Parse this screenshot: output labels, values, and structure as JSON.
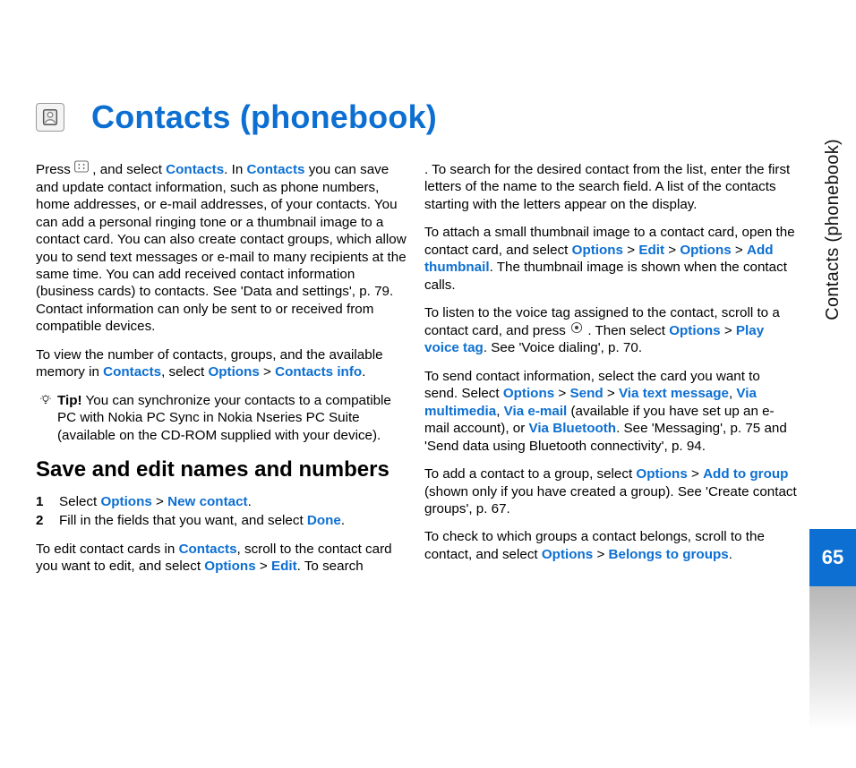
{
  "title": "Contacts (phonebook)",
  "side": {
    "label": "Contacts (phonebook)",
    "page": "65"
  },
  "intro": {
    "p1a": "Press ",
    "p1b": " , and select ",
    "p1c": "Contacts",
    "p1d": ". In ",
    "p1e": "Contacts",
    "p1f": " you can save and update contact information, such as phone numbers, home addresses, or e-mail addresses, of your contacts. You can add a personal ringing tone or a thumbnail image to a contact card. You can also create contact groups, which allow you to send text messages or e-mail to many recipients at the same time. You can add received contact information (business cards) to contacts. See 'Data and settings', p. 79. Contact information can only be sent to or received from compatible devices."
  },
  "view": {
    "a": "To view the number of contacts, groups, and the available memory in ",
    "contacts": "Contacts",
    "b": ", select ",
    "options": "Options",
    "gt": " > ",
    "cinfo": "Contacts info",
    "end": "."
  },
  "tip": {
    "label": "Tip!",
    "text": " You can synchronize your contacts to a compatible PC with Nokia PC Sync in Nokia Nseries PC Suite (available on the CD-ROM supplied with your device)."
  },
  "subheading": "Save and edit names and numbers",
  "steps": {
    "n1": "1",
    "s1a": "Select ",
    "s1_options": "Options",
    "gt": " > ",
    "s1_new": "New contact",
    "s1b": ".",
    "n2": "2",
    "s2a": "Fill in the fields that you want, and select ",
    "s2_done": "Done",
    "s2b": "."
  },
  "editcards": {
    "a": "To edit contact cards in ",
    "contacts": "Contacts",
    "b": ", scroll to the contact card you want to edit, and select ",
    "options": "Options",
    "gt": " > ",
    "edit": "Edit",
    "c": ". To search for the desired contact from the list, enter the first letters of the name to the search field. A list of the contacts starting with the letters appear on the display."
  },
  "thumb": {
    "a": "To attach a small thumbnail image to a contact card, open the contact card, and select ",
    "options1": "Options",
    "gt": " > ",
    "edit": "Edit",
    "options2": "Options",
    "addthumb": "Add thumbnail",
    "b": ". The thumbnail image is shown when the contact calls."
  },
  "voice": {
    "a": "To listen to the voice tag assigned to the contact, scroll to a contact card, and press ",
    "b": " . Then select ",
    "options": "Options",
    "gt": " > ",
    "play": "Play voice tag",
    "c": ". See 'Voice dialing', p. 70."
  },
  "send": {
    "a": "To send contact information, select the card you want to send. Select ",
    "options": "Options",
    "gt": " > ",
    "sendlabel": "Send",
    "viatext": "Via text message",
    "sep": ", ",
    "viamm": "Via multimedia",
    "viaemail": "Via e-mail",
    "b": " (available if you have set up an e-mail account), or ",
    "viabt": "Via Bluetooth",
    "c": ". See 'Messaging', p. 75 and 'Send data using Bluetooth connectivity', p. 94."
  },
  "addgroup": {
    "a": "To add a contact to a group, select ",
    "options": "Options",
    "gt": " > ",
    "add": "Add to group",
    "b": " (shown only if you have created a group). See 'Create contact groups', p. 67."
  },
  "belongs": {
    "a": "To check to which groups a contact belongs, scroll to the contact, and select ",
    "options": "Options",
    "gt": " > ",
    "bel": "Belongs to groups",
    "b": "."
  }
}
